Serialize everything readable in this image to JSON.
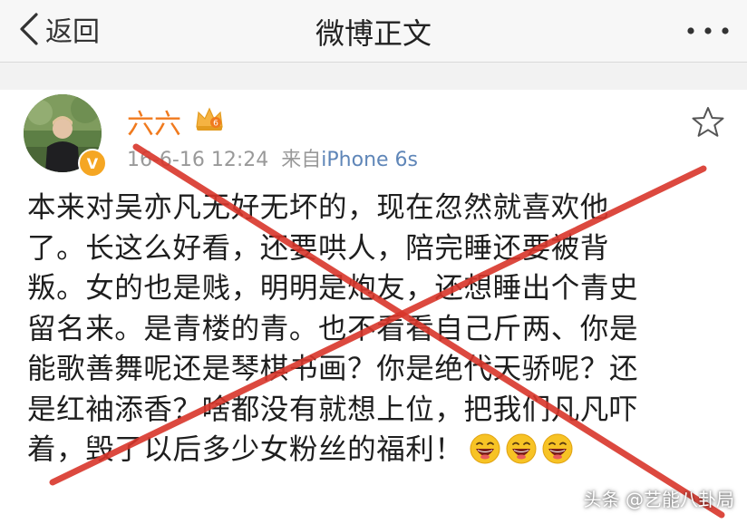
{
  "nav": {
    "back_label": "返回",
    "title": "微博正文"
  },
  "post": {
    "username": "六六",
    "timestamp": "16-6-16 12:24",
    "source_prefix": "来自",
    "source": "iPhone 6s",
    "lines": [
      "本来对吴亦凡无好无坏的，现在忽然就喜欢他",
      "了。长这么好看，还要哄人，陪完睡还要被背",
      "叛。女的也是贱，明明是炮友，还想睡出个青史",
      "留名来。是青楼的青。也不看看自己斤两、你是",
      "能歌善舞呢还是琴棋书画？你是绝代天骄呢？还",
      "是红袖添香？啥都没有就想上位，把我们凡凡吓",
      "着，毁了以后多少女粉丝的福利！"
    ],
    "emoji_count": 3,
    "emoji_icon": "laughing-face-icon"
  },
  "watermark": "头条 @艺能八卦局",
  "colors": {
    "username": "#f07a1e",
    "source": "#5f86b8",
    "cross": "#d9362b",
    "vip_badge": "#f5a623"
  }
}
